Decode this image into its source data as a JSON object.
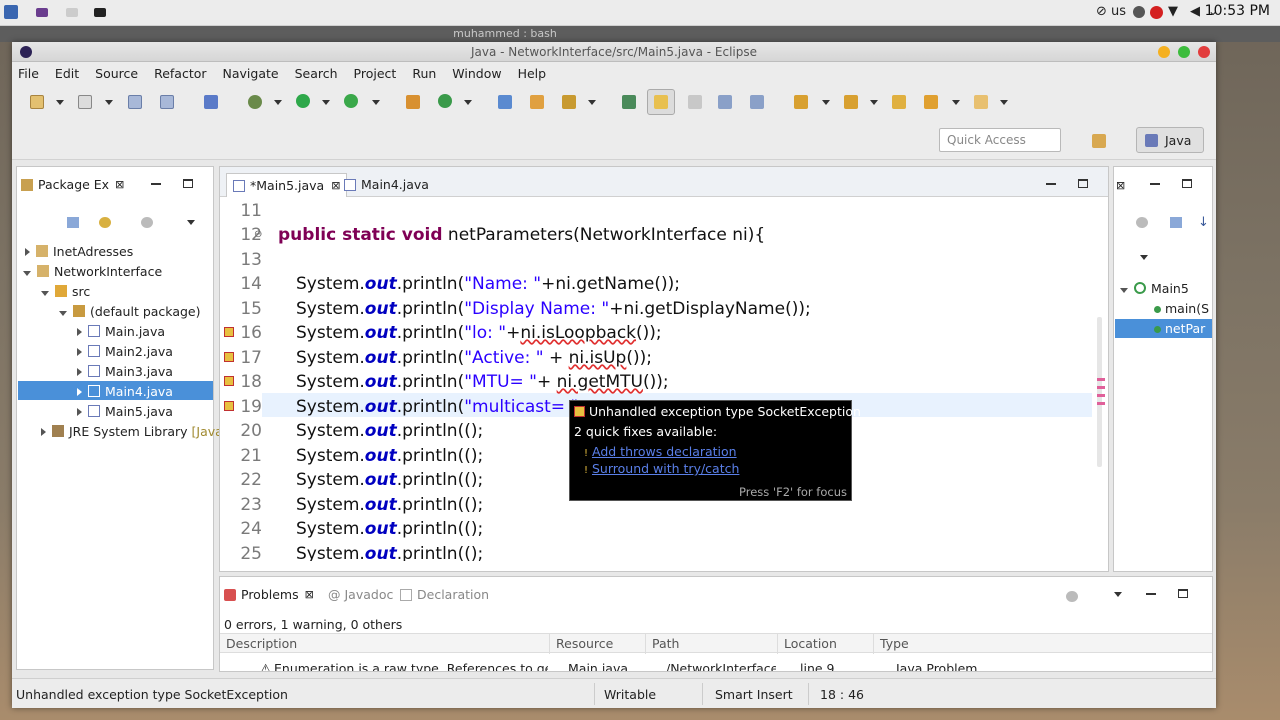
{
  "system": {
    "lang_indicator": "us",
    "clock": "10:53 PM",
    "bash_title": "muhammed : bash"
  },
  "window": {
    "title": "Java - NetworkInterface/src/Main5.java - Eclipse"
  },
  "menu": [
    "File",
    "Edit",
    "Source",
    "Refactor",
    "Navigate",
    "Search",
    "Project",
    "Run",
    "Window",
    "Help"
  ],
  "toolbar": {
    "quick_access_placeholder": "Quick Access",
    "perspective_label": "Java"
  },
  "package_explorer": {
    "tab_label": "Package Ex",
    "items": [
      {
        "label": "InetAdresses"
      },
      {
        "label": "NetworkInterface"
      },
      {
        "label": "src"
      },
      {
        "label": "(default package)"
      },
      {
        "label": "Main.java"
      },
      {
        "label": "Main2.java"
      },
      {
        "label": "Main3.java"
      },
      {
        "label": "Main4.java"
      },
      {
        "label": "Main5.java"
      },
      {
        "label": "JRE System Library",
        "suffix": "[Java"
      }
    ]
  },
  "editor": {
    "tabs": [
      {
        "label": "*Main5.java"
      },
      {
        "label": "Main4.java"
      }
    ],
    "lines": [
      {
        "num": "11"
      },
      {
        "num": "12"
      },
      {
        "num": "13"
      },
      {
        "num": "14"
      },
      {
        "num": "15"
      },
      {
        "num": "16"
      },
      {
        "num": "17"
      },
      {
        "num": "18"
      },
      {
        "num": "19"
      },
      {
        "num": "20"
      },
      {
        "num": "21"
      },
      {
        "num": "22"
      },
      {
        "num": "23"
      },
      {
        "num": "24"
      },
      {
        "num": "25"
      }
    ],
    "code": {
      "l12_kw": "public static void",
      "l12_rest": " netParameters(NetworkInterface ni){",
      "sys": "System.",
      "out": "out",
      "println": ".println(",
      "l14_str": "\"Name: \"",
      "l14_rest": "+ni.getName());",
      "l15_str": "\"Display Name: \"",
      "l15_rest": "+ni.getDisplayName());",
      "l16_str": "\"lo: \"",
      "l16_plus": "+",
      "l16_err": "ni.isLoopback",
      "l16_rest": "());",
      "l17_str": "\"Active: \"",
      "l17_plus": " + ",
      "l17_err": "ni.isUp",
      "l17_rest": "());",
      "l18_str": "\"MTU= \"",
      "l18_plus": "+ ",
      "l18_err": "ni.getMTU",
      "l18_rest": "());",
      "l19_str": "\"multicast= \"",
      "empty_println": "();"
    }
  },
  "quickfix_popup": {
    "title": "Unhandled exception type SocketException",
    "subtitle": "2 quick fixes available:",
    "fixes": [
      "Add throws declaration",
      "Surround with try/catch"
    ],
    "footer": "Press 'F2' for focus"
  },
  "outline": {
    "class_name": "Main5",
    "methods": [
      "main(S",
      "netPar"
    ]
  },
  "problems": {
    "tabs": [
      "Problems",
      "Javadoc",
      "Declaration"
    ],
    "summary": "0 errors, 1 warning, 0 others",
    "columns": [
      "Description",
      "Resource",
      "Path",
      "Location",
      "Type"
    ],
    "row": [
      "Enumeration is a raw type. References to gen",
      "Main.java",
      "/NetworkInterface/",
      "line 9",
      "Java Problem"
    ]
  },
  "status": {
    "message": "Unhandled exception type SocketException",
    "mode": "Writable",
    "insert": "Smart Insert",
    "position": "18 : 46"
  },
  "colors": {
    "keyword": "#7f0055",
    "field": "#0000c0",
    "string": "#2a00ff",
    "selection": "#4a90d9"
  }
}
